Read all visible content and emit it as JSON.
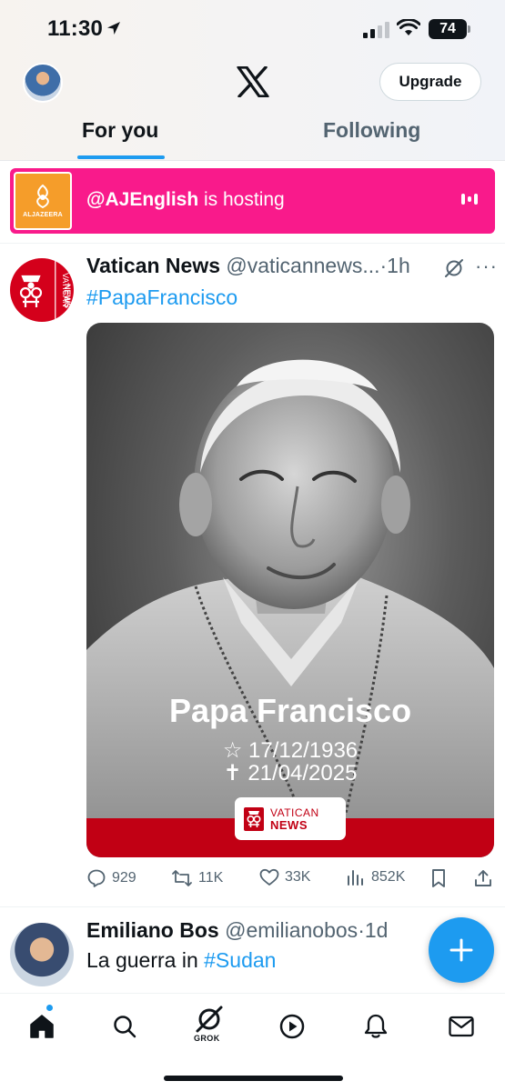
{
  "status_bar": {
    "time": "11:30",
    "battery": "74"
  },
  "header": {
    "upgrade_label": "Upgrade"
  },
  "tabs": [
    {
      "label": "For you",
      "selected": true
    },
    {
      "label": "Following",
      "selected": false
    }
  ],
  "spaces_banner": {
    "host": "@AJEnglish",
    "suffix": " is hosting",
    "logo_text": "ALJAZEERA",
    "color": "#f91a8b"
  },
  "post": {
    "author": "Vatican News",
    "handle": "@vaticannews...",
    "time": "·1h",
    "hashtag": "#PapaFrancisco",
    "avatar_text": "VATICAN NEWS",
    "media": {
      "title": "Papa Francisco",
      "born": "☆ 17/12/1936",
      "died": "✝ 21/04/2025",
      "badge_top": "VATICAN",
      "badge_bottom": "NEWS"
    },
    "actions": {
      "replies": "929",
      "reposts": "11K",
      "likes": "33K",
      "views": "852K"
    }
  },
  "post2": {
    "author": "Emiliano Bos",
    "handle": "@emilianobos",
    "time": "·1d",
    "text": "La guerra in ",
    "tag": "#Sudan"
  },
  "bottom_nav": {
    "items": [
      "home-icon",
      "search-icon",
      "grok-icon",
      "video-icon",
      "notifications-icon",
      "messages-icon"
    ],
    "grok_label": "GROK"
  },
  "colors": {
    "accent": "#1d9bf0",
    "vatican_red": "#c10014",
    "spaces_pink": "#f91a8b"
  }
}
